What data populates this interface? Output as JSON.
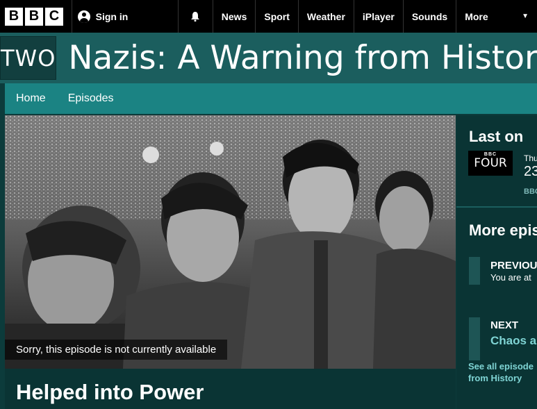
{
  "global_nav": {
    "logo_letters": [
      "B",
      "B",
      "C"
    ],
    "sign_in": "Sign in",
    "items": [
      "News",
      "Sport",
      "Weather",
      "iPlayer",
      "Sounds"
    ],
    "more": "More"
  },
  "brand": {
    "channel_logo": "TWO",
    "title": "Nazis: A Warning from History"
  },
  "subnav": {
    "items": [
      "Home",
      "Episodes"
    ]
  },
  "hero": {
    "caption": "Sorry, this episode is not currently available"
  },
  "episode": {
    "title": "Helped into Power"
  },
  "last_on": {
    "heading": "Last on",
    "channel_mini": "BBC",
    "channel": "FOUR",
    "day": "Thu",
    "time": "23",
    "channel_link": "BBC"
  },
  "more_episodes": {
    "heading": "More epis",
    "previous_label": "PREVIOU",
    "previous_text": "You are at",
    "next_label": "NEXT",
    "next_title": "Chaos a",
    "see_all": "See all episode from History"
  }
}
